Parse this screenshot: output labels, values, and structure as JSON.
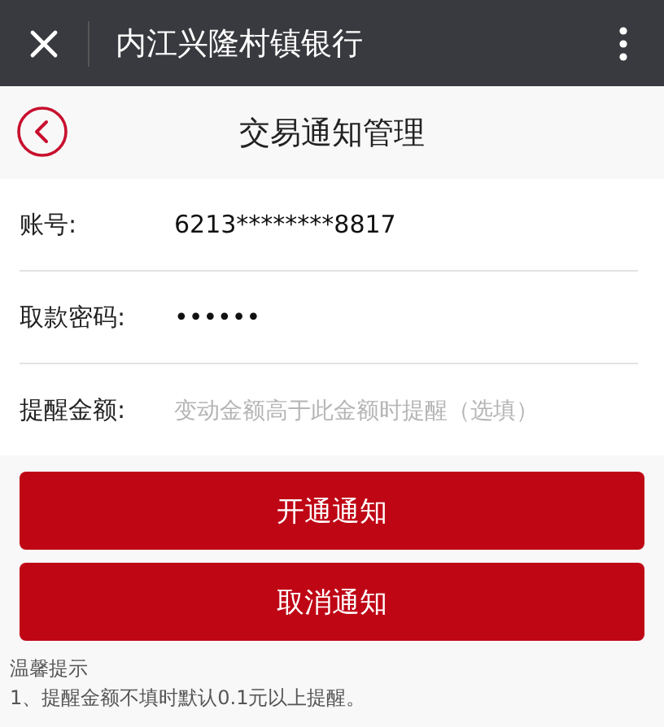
{
  "top_bar": {
    "title": "内江兴隆村镇银行"
  },
  "header": {
    "title": "交易通知管理"
  },
  "fields": [
    {
      "label": "账号:",
      "value": "6213********8817"
    },
    {
      "label": "取款密码:",
      "value": "••••••"
    },
    {
      "label": "提醒金额:",
      "placeholder": "变动金额高于此金额时提醒（选填）"
    }
  ],
  "buttons": [
    "开通通知",
    "取消通知"
  ],
  "tips": {
    "title": "温馨提示",
    "lines": [
      "1、提醒金额不填时默认0.1元以上提醒。"
    ]
  }
}
